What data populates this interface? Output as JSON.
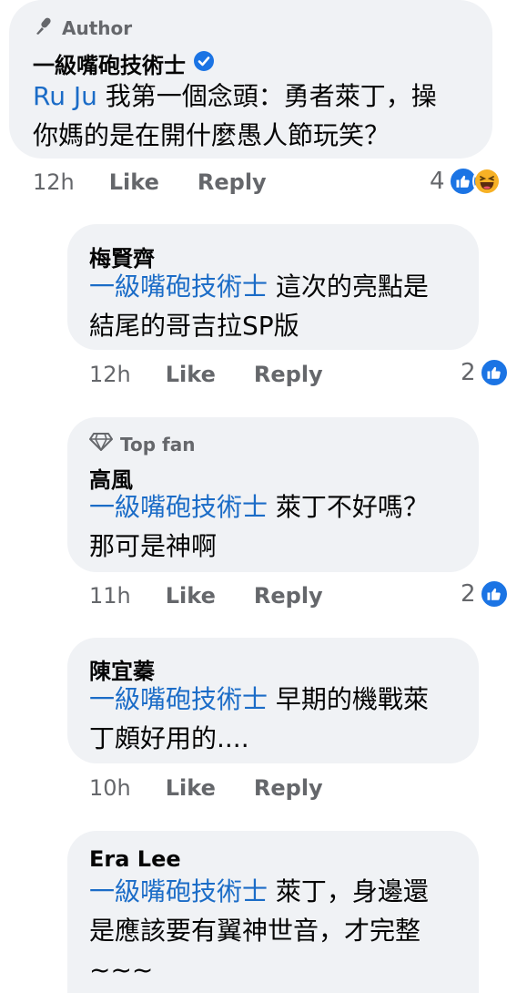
{
  "comments": [
    {
      "badge": "Author",
      "badge_icon": "microphone-icon",
      "name": "一級嘴砲技術士",
      "verified": true,
      "mention": "Ru Ju",
      "line1": " 我第一個念頭：勇者萊丁，操",
      "line2": "你媽的是在開什麼愚人節玩笑？",
      "time": "12h",
      "like": "Like",
      "reply": "Reply",
      "reaction_count": "4",
      "reactions": [
        "like-icon",
        "haha-icon"
      ]
    },
    {
      "name": "梅賢齊",
      "mention": "一級嘴砲技術士",
      "line1": " 這次的亮點是",
      "line2": "結尾的哥吉拉SP版",
      "time": "12h",
      "like": "Like",
      "reply": "Reply",
      "reaction_count": "2",
      "reactions": [
        "like-icon"
      ]
    },
    {
      "badge": "Top fan",
      "badge_icon": "diamond-icon",
      "name": "高風",
      "mention": "一級嘴砲技術士",
      "line1": " 萊丁不好嗎？",
      "line2": "那可是神啊",
      "time": "11h",
      "like": "Like",
      "reply": "Reply",
      "reaction_count": "2",
      "reactions": [
        "like-icon"
      ]
    },
    {
      "name": "陳宜蓁",
      "mention": "一級嘴砲技術士",
      "line1": " 早期的機戰萊",
      "line2": "丁頗好用的....",
      "time": "10h",
      "like": "Like",
      "reply": "Reply"
    },
    {
      "name": "Era Lee",
      "mention": "一級嘴砲技術士",
      "line1": " 萊丁，身邊還",
      "line2": "是應該要有翼神世音，才完整",
      "line3": "~~~"
    }
  ],
  "colors": {
    "bubble": "#f0f2f5",
    "mention": "#1b6cc7",
    "like": "#1b74e4",
    "meta": "#65676b"
  }
}
